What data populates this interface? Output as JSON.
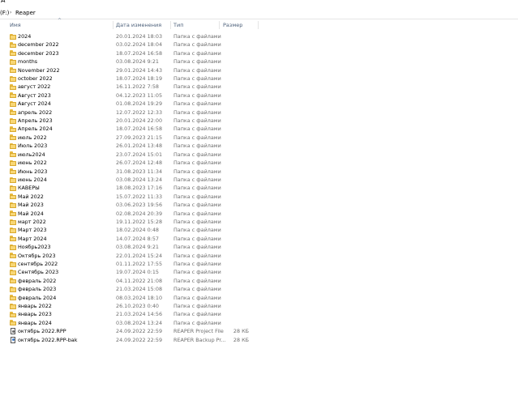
{
  "window": {
    "top_partial_text": "д"
  },
  "address_bar": {
    "drive": "(F:)",
    "separator_glyph": "›",
    "folder": "Reaper"
  },
  "columns": {
    "name": "Имя",
    "date": "Дата изменения",
    "type": "Тип",
    "size": "Размер"
  },
  "sort_indicator_glyph": "^",
  "items": [
    {
      "name": "2024",
      "date": "20.01.2024 18:03",
      "type": "Папка с файлами",
      "size": "",
      "icon": "folder-icon"
    },
    {
      "name": "december 2022",
      "date": "03.02.2024 18:04",
      "type": "Папка с файлами",
      "size": "",
      "icon": "folder-icon"
    },
    {
      "name": "december 2023",
      "date": "18.07.2024 16:58",
      "type": "Папка с файлами",
      "size": "",
      "icon": "folder-icon"
    },
    {
      "name": "months",
      "date": "03.08.2024 9:21",
      "type": "Папка с файлами",
      "size": "",
      "icon": "folder-icon"
    },
    {
      "name": "November 2022",
      "date": "29.01.2024 14:43",
      "type": "Папка с файлами",
      "size": "",
      "icon": "folder-icon"
    },
    {
      "name": "october 2022",
      "date": "18.07.2024 18:19",
      "type": "Папка с файлами",
      "size": "",
      "icon": "folder-icon"
    },
    {
      "name": "август 2022",
      "date": "16.11.2022 7:58",
      "type": "Папка с файлами",
      "size": "",
      "icon": "folder-icon"
    },
    {
      "name": "Август 2023",
      "date": "04.12.2023 11:05",
      "type": "Папка с файлами",
      "size": "",
      "icon": "folder-icon"
    },
    {
      "name": "Август 2024",
      "date": "01.08.2024 19:29",
      "type": "Папка с файлами",
      "size": "",
      "icon": "folder-icon"
    },
    {
      "name": "апрель 2022",
      "date": "12.07.2022 12:33",
      "type": "Папка с файлами",
      "size": "",
      "icon": "folder-icon"
    },
    {
      "name": "Апрель 2023",
      "date": "20.01.2024 22:00",
      "type": "Папка с файлами",
      "size": "",
      "icon": "folder-icon"
    },
    {
      "name": "Апрель 2024",
      "date": "18.07.2024 16:58",
      "type": "Папка с файлами",
      "size": "",
      "icon": "folder-icon"
    },
    {
      "name": "июль 2022",
      "date": "27.09.2023 21:15",
      "type": "Папка с файлами",
      "size": "",
      "icon": "folder-icon"
    },
    {
      "name": "Июль 2023",
      "date": "26.01.2024 13:48",
      "type": "Папка с файлами",
      "size": "",
      "icon": "folder-icon"
    },
    {
      "name": "июль2024",
      "date": "23.07.2024 15:01",
      "type": "Папка с файлами",
      "size": "",
      "icon": "folder-icon"
    },
    {
      "name": "июнь 2022",
      "date": "26.07.2024 12:48",
      "type": "Папка с файлами",
      "size": "",
      "icon": "folder-icon"
    },
    {
      "name": "Июнь 2023",
      "date": "31.08.2023 11:34",
      "type": "Папка с файлами",
      "size": "",
      "icon": "folder-icon"
    },
    {
      "name": "июнь 2024",
      "date": "03.08.2024 13:24",
      "type": "Папка с файлами",
      "size": "",
      "icon": "folder-icon"
    },
    {
      "name": "КАВЕРЫ",
      "date": "18.08.2023 17:16",
      "type": "Папка с файлами",
      "size": "",
      "icon": "folder-icon"
    },
    {
      "name": "Май 2022",
      "date": "15.07.2022 11:33",
      "type": "Папка с файлами",
      "size": "",
      "icon": "folder-icon"
    },
    {
      "name": "Май 2023",
      "date": "03.06.2023 19:56",
      "type": "Папка с файлами",
      "size": "",
      "icon": "folder-icon"
    },
    {
      "name": "Май 2024",
      "date": "02.08.2024 20:39",
      "type": "Папка с файлами",
      "size": "",
      "icon": "folder-icon"
    },
    {
      "name": "март 2022",
      "date": "19.11.2022 15:28",
      "type": "Папка с файлами",
      "size": "",
      "icon": "folder-icon"
    },
    {
      "name": "Март 2023",
      "date": "18.02.2024 0:48",
      "type": "Папка с файлами",
      "size": "",
      "icon": "folder-icon"
    },
    {
      "name": "Март 2024",
      "date": "14.07.2024 8:57",
      "type": "Папка с файлами",
      "size": "",
      "icon": "folder-icon"
    },
    {
      "name": "Ноябрь2023",
      "date": "03.08.2024 9:21",
      "type": "Папка с файлами",
      "size": "",
      "icon": "folder-icon"
    },
    {
      "name": "Октябрь 2023",
      "date": "22.01.2024 15:24",
      "type": "Папка с файлами",
      "size": "",
      "icon": "folder-icon"
    },
    {
      "name": "сентябрь 2022",
      "date": "01.11.2022 17:55",
      "type": "Папка с файлами",
      "size": "",
      "icon": "folder-icon"
    },
    {
      "name": "Сентябрь 2023",
      "date": "19.07.2024 0:15",
      "type": "Папка с файлами",
      "size": "",
      "icon": "folder-icon"
    },
    {
      "name": "февраль 2022",
      "date": "04.11.2022 21:08",
      "type": "Папка с файлами",
      "size": "",
      "icon": "folder-icon"
    },
    {
      "name": "февраль 2023",
      "date": "21.03.2024 15:08",
      "type": "Папка с файлами",
      "size": "",
      "icon": "folder-icon"
    },
    {
      "name": "февраль 2024",
      "date": "08.03.2024 18:10",
      "type": "Папка с файлами",
      "size": "",
      "icon": "folder-icon"
    },
    {
      "name": "январь 2022",
      "date": "26.10.2023 0:40",
      "type": "Папка с файлами",
      "size": "",
      "icon": "folder-icon"
    },
    {
      "name": "январь 2023",
      "date": "21.03.2024 14:56",
      "type": "Папка с файлами",
      "size": "",
      "icon": "folder-icon"
    },
    {
      "name": "январь 2024",
      "date": "03.08.2024 13:24",
      "type": "Папка с файлами",
      "size": "",
      "icon": "folder-icon"
    },
    {
      "name": "октябрь 2022.RPP",
      "date": "24.09.2022 22:59",
      "type": "REAPER Project File",
      "size": "28 КБ",
      "icon": "reaper-project-file-icon"
    },
    {
      "name": "октябрь 2022.RPP-bak",
      "date": "24.09.2022 22:59",
      "type": "REAPER Backup Pr...",
      "size": "28 КБ",
      "icon": "reaper-backup-file-icon"
    }
  ]
}
